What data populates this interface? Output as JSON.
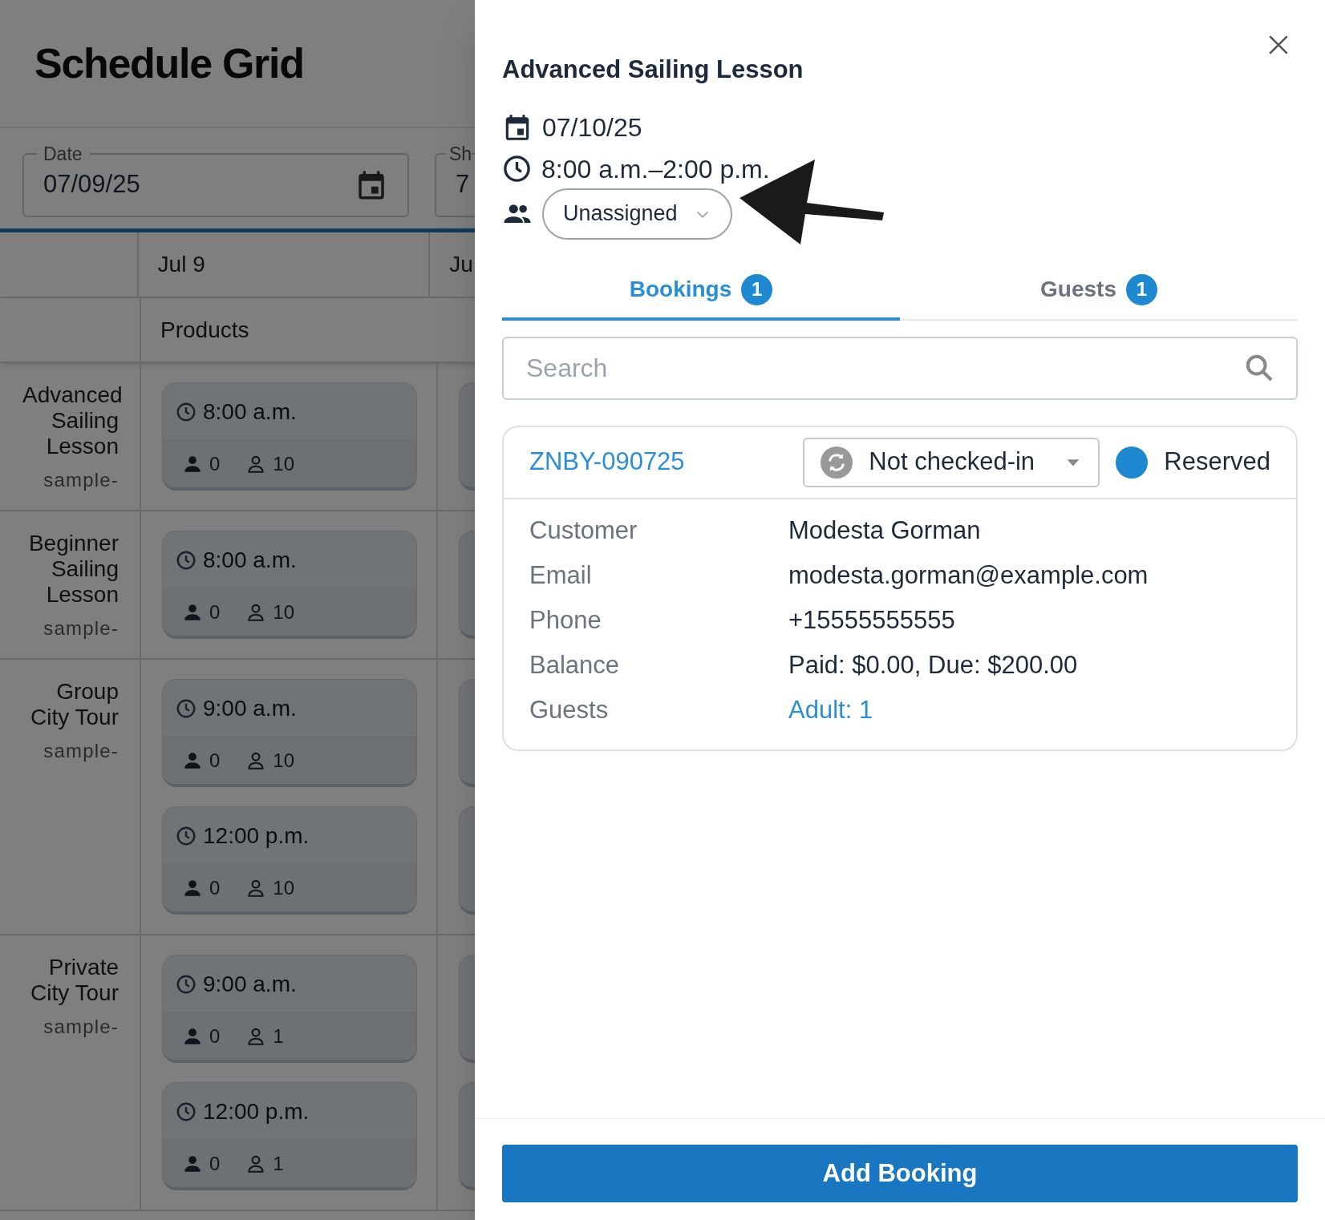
{
  "page": {
    "title": "Schedule Grid"
  },
  "filters": [
    {
      "label": "Date",
      "value": "07/09/25",
      "kind": "date"
    },
    {
      "label": "Sh",
      "value": "7",
      "kind": "text"
    }
  ],
  "grid": {
    "columns": [
      "Jul 9",
      "Ju"
    ],
    "subheader": "Products",
    "rows": [
      {
        "name": "Advanced Sailing Lesson",
        "sku": "sample-",
        "slots": [
          {
            "time": "8:00 a.m.",
            "booked": "0",
            "capacity": "10"
          }
        ]
      },
      {
        "name": "Beginner Sailing Lesson",
        "sku": "sample-",
        "slots": [
          {
            "time": "8:00 a.m.",
            "booked": "0",
            "capacity": "10"
          }
        ]
      },
      {
        "name": "Group City Tour",
        "sku": "sample-",
        "slots": [
          {
            "time": "9:00 a.m.",
            "booked": "0",
            "capacity": "10"
          },
          {
            "time": "12:00 p.m.",
            "booked": "0",
            "capacity": "10"
          }
        ]
      },
      {
        "name": "Private City Tour",
        "sku": "sample-",
        "slots": [
          {
            "time": "9:00 a.m.",
            "booked": "0",
            "capacity": "1"
          },
          {
            "time": "12:00 p.m.",
            "booked": "0",
            "capacity": "1"
          }
        ]
      }
    ]
  },
  "drawer": {
    "title": "Advanced Sailing Lesson",
    "date": "07/10/25",
    "time_range": "8:00 a.m.–2:00 p.m.",
    "staff": "Unassigned",
    "tabs": [
      {
        "label": "Bookings",
        "count": "1",
        "selected": true
      },
      {
        "label": "Guests",
        "count": "1",
        "selected": false
      }
    ],
    "search": {
      "placeholder": "Search"
    },
    "bookings": [
      {
        "code": "ZNBY-090725",
        "checkin": "Not checked-in",
        "status": {
          "label": "Reserved",
          "color": "#1e88d0"
        },
        "fields": [
          {
            "label": "Customer",
            "value": "Modesta Gorman",
            "kind": "text"
          },
          {
            "label": "Email",
            "value": "modesta.gorman@example.com",
            "kind": "text"
          },
          {
            "label": "Phone",
            "value": "+15555555555",
            "kind": "text"
          },
          {
            "label": "Balance",
            "value": "Paid: $0.00, Due: $200.00",
            "kind": "text"
          },
          {
            "label": "Guests",
            "value": "Adult: 1",
            "kind": "link"
          }
        ]
      }
    ],
    "primary_button": "Add Booking"
  }
}
